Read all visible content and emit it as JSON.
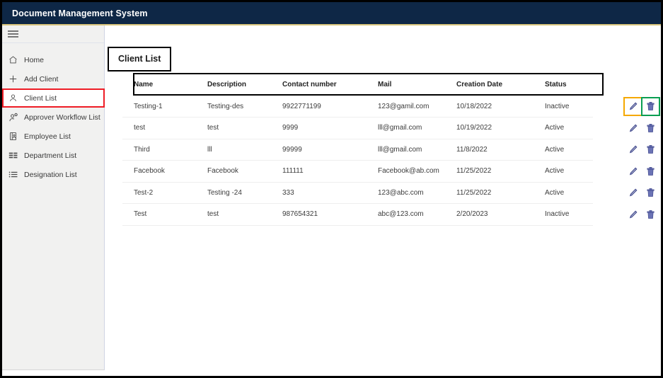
{
  "header": {
    "title": "Document Management System",
    "navy": "#0e2746",
    "accent_underline": "#d8c47c",
    "menu_icon": "hamburger-icon"
  },
  "sidebar": {
    "active_index": 2,
    "highlight_color": "#ee1c25",
    "items": [
      {
        "label": "Home",
        "icon": "home-icon"
      },
      {
        "label": "Add Client",
        "icon": "plus-icon"
      },
      {
        "label": "Client List",
        "icon": "user-icon"
      },
      {
        "label": "Approver Workflow List",
        "icon": "user-gear-icon"
      },
      {
        "label": "Employee List",
        "icon": "id-badge-icon"
      },
      {
        "label": "Department List",
        "icon": "table-grid-icon"
      },
      {
        "label": "Designation List",
        "icon": "list-icon"
      }
    ]
  },
  "main": {
    "page_title": "Client List",
    "table": {
      "columns": [
        "Name",
        "Description",
        "Contact number",
        "Mail",
        "Creation Date",
        "Status"
      ],
      "rows": [
        {
          "name": "Testing-1",
          "description": "Testing-des",
          "contact_number": "9922771199",
          "mail": "123@gamil.com",
          "creation_date": "10/18/2022",
          "status": "Inactive"
        },
        {
          "name": "test",
          "description": "test",
          "contact_number": "9999",
          "mail": "lll@gmail.com",
          "creation_date": "10/19/2022",
          "status": "Active"
        },
        {
          "name": "Third",
          "description": "lll",
          "contact_number": "99999",
          "mail": "lll@gmail.com",
          "creation_date": "11/8/2022",
          "status": "Active"
        },
        {
          "name": "Facebook",
          "description": "Facebook",
          "contact_number": "111111",
          "mail": "Facebook@ab.com",
          "creation_date": "11/25/2022",
          "status": "Active"
        },
        {
          "name": "Test-2",
          "description": "Testing -24",
          "contact_number": "333",
          "mail": "123@abc.com",
          "creation_date": "11/25/2022",
          "status": "Active"
        },
        {
          "name": "Test",
          "description": "test",
          "contact_number": "987654321",
          "mail": "abc@123.com",
          "creation_date": "2/20/2023",
          "status": "Inactive"
        }
      ],
      "actions": {
        "edit_icon": "pencil-icon",
        "delete_icon": "trash-icon",
        "icon_color": "#474f91",
        "edit_highlight_color": "#f5a800",
        "delete_highlight_color": "#0a9e52"
      }
    }
  }
}
